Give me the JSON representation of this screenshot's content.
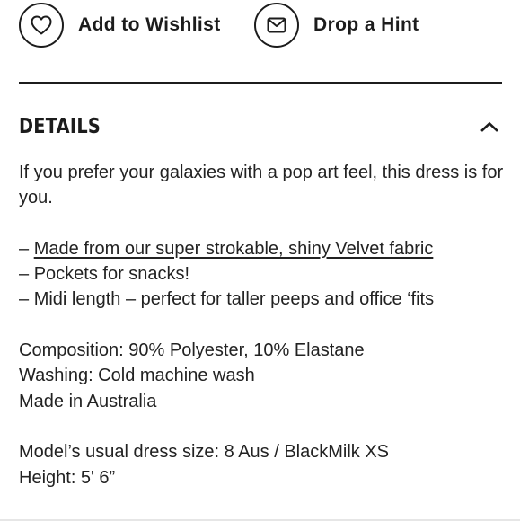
{
  "actions": {
    "wishlist_label": "Add to Wishlist",
    "hint_label": "Drop a Hint"
  },
  "details": {
    "title": "DETAILS",
    "intro": "If you prefer your galaxies with a pop art feel, this dress is for you.",
    "bullet_prefix": "– ",
    "features": [
      "Made from our super strokable, shiny Velvet fabric",
      "Pockets for snacks!",
      "Midi length – perfect for taller peeps and office ‘fits"
    ],
    "composition": "Composition: 90% Polyester, 10% Elastane",
    "washing": "Washing: Cold machine wash",
    "origin": "Made in Australia",
    "model_size": "Model’s usual dress size: 8 Aus / BlackMilk XS",
    "height": "Height: 5' 6”"
  },
  "icons": {
    "wishlist": "heart-icon",
    "hint": "envelope-icon",
    "toggle": "chevron-up-icon"
  },
  "colors": {
    "text": "#1c1c1c",
    "divider": "#1c1c1c",
    "background": "#ffffff"
  }
}
